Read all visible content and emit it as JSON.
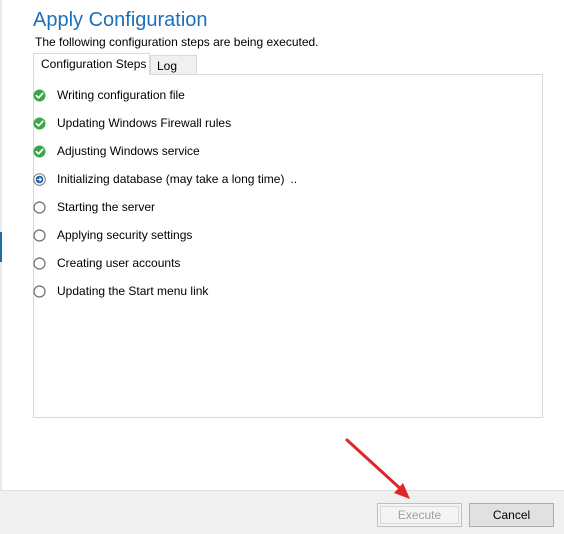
{
  "header": {
    "title": "Apply Configuration",
    "subtitle": "The following configuration steps are being executed."
  },
  "tabs": [
    {
      "label": "Configuration Steps",
      "active": true
    },
    {
      "label": "Log",
      "active": false
    }
  ],
  "steps": [
    {
      "label": "Writing configuration file",
      "status": "done",
      "icon": "check-icon"
    },
    {
      "label": "Updating Windows Firewall rules",
      "status": "done",
      "icon": "check-icon"
    },
    {
      "label": "Adjusting Windows service",
      "status": "done",
      "icon": "check-icon"
    },
    {
      "label": "Initializing database (may take a long time)",
      "suffix": "..",
      "status": "in-progress",
      "icon": "current-step-icon"
    },
    {
      "label": "Starting the server",
      "status": "pending",
      "icon": "pending-circle-icon"
    },
    {
      "label": "Applying security settings",
      "status": "pending",
      "icon": "pending-circle-icon"
    },
    {
      "label": "Creating user accounts",
      "status": "pending",
      "icon": "pending-circle-icon"
    },
    {
      "label": "Updating the Start menu link",
      "status": "pending",
      "icon": "pending-circle-icon"
    }
  ],
  "footer": {
    "execute_label": "Execute",
    "execute_enabled": false,
    "cancel_label": "Cancel"
  },
  "colors": {
    "title": "#1e6fb8",
    "check": "#3aa84a",
    "current": "#1d5fa8",
    "annotation_arrow": "#e0262b"
  }
}
